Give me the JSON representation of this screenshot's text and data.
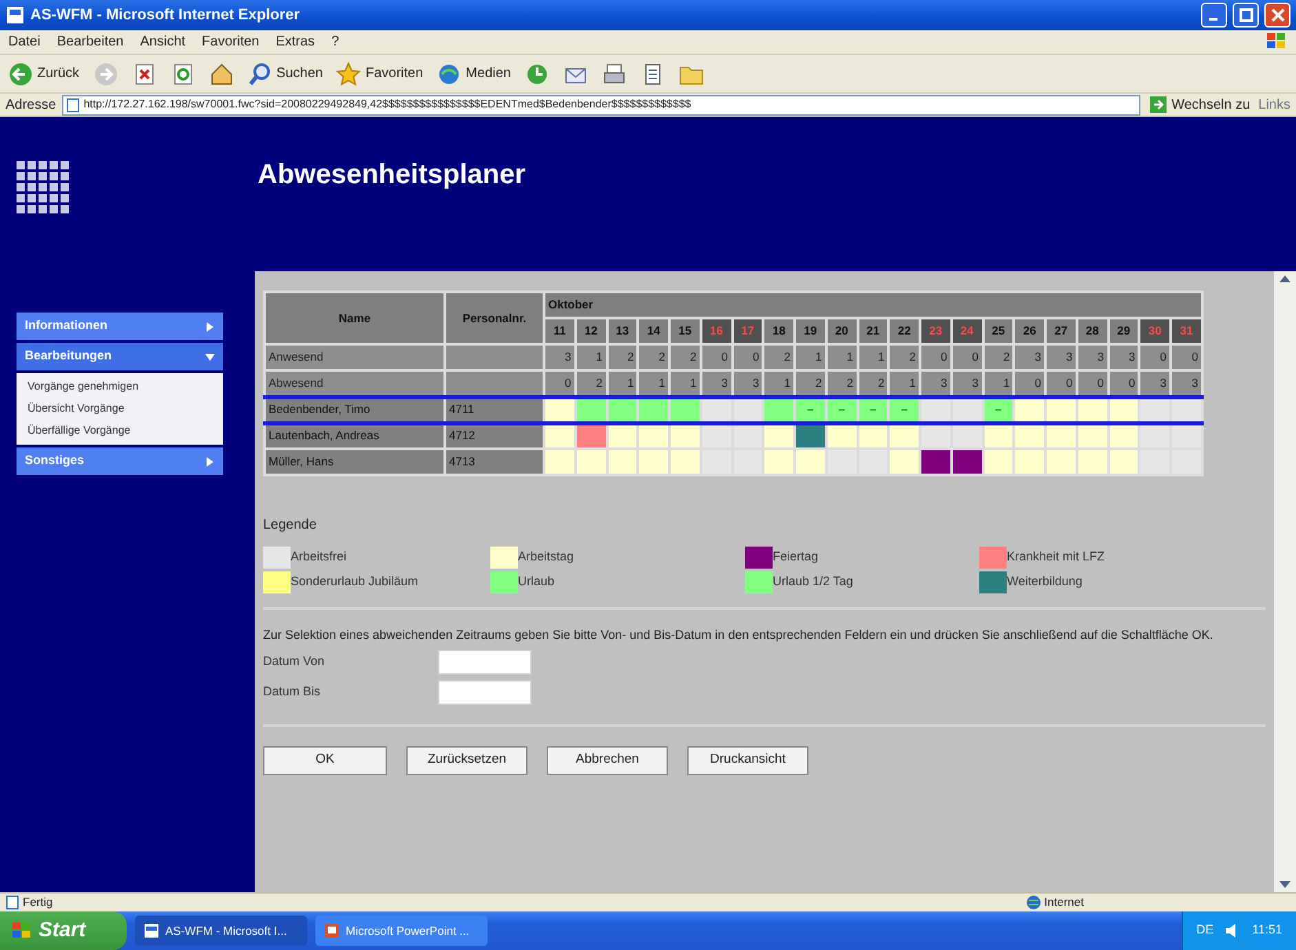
{
  "window": {
    "title": "AS-WFM - Microsoft Internet Explorer"
  },
  "menu": [
    "Datei",
    "Bearbeiten",
    "Ansicht",
    "Favoriten",
    "Extras",
    "?"
  ],
  "toolbar": [
    {
      "kind": "back",
      "label": "Zurück"
    },
    {
      "kind": "forward"
    },
    {
      "kind": "stop"
    },
    {
      "kind": "refresh"
    },
    {
      "kind": "home"
    },
    {
      "kind": "search",
      "label": "Suchen"
    },
    {
      "kind": "favorites",
      "label": "Favoriten"
    },
    {
      "kind": "media",
      "label": "Medien"
    },
    {
      "kind": "history"
    },
    {
      "kind": "mail"
    },
    {
      "kind": "print"
    },
    {
      "kind": "edit"
    },
    {
      "kind": "folder"
    }
  ],
  "address": {
    "label": "Adresse",
    "url": "http://172.27.162.198/sw70001.fwc?sid=20080229492849,42$$$$$$$$$$$$$$$$EDENTmed$Bedenbender$$$$$$$$$$$$$",
    "go": "Wechseln zu",
    "links": "Links"
  },
  "page": {
    "title": "Abwesenheitsplaner"
  },
  "sidebar": {
    "items": [
      {
        "label": "Informationen",
        "expanded": false
      },
      {
        "label": "Bearbeitungen",
        "expanded": true,
        "children": [
          {
            "label": "Vorgänge genehmigen"
          },
          {
            "label": "Übersicht Vorgänge"
          },
          {
            "label": "Überfällige Vorgänge"
          }
        ]
      },
      {
        "label": "Sonstiges",
        "expanded": false
      }
    ]
  },
  "planner": {
    "columns": [
      "Name",
      "Personalnr."
    ],
    "month": "Oktober",
    "days": [
      {
        "label": "11",
        "weekend": false
      },
      {
        "label": "12",
        "weekend": false
      },
      {
        "label": "13",
        "weekend": false
      },
      {
        "label": "14",
        "weekend": false
      },
      {
        "label": "15",
        "weekend": false
      },
      {
        "label": "16",
        "weekend": true
      },
      {
        "label": "17",
        "weekend": true
      },
      {
        "label": "18",
        "weekend": false
      },
      {
        "label": "19",
        "weekend": false
      },
      {
        "label": "20",
        "weekend": false
      },
      {
        "label": "21",
        "weekend": false
      },
      {
        "label": "22",
        "weekend": false
      },
      {
        "label": "23",
        "weekend": true
      },
      {
        "label": "24",
        "weekend": true
      },
      {
        "label": "25",
        "weekend": false
      },
      {
        "label": "26",
        "weekend": false
      },
      {
        "label": "27",
        "weekend": false
      },
      {
        "label": "28",
        "weekend": false
      },
      {
        "label": "29",
        "weekend": false
      },
      {
        "label": "30",
        "weekend": true
      },
      {
        "label": "31",
        "weekend": true
      }
    ],
    "summary": [
      {
        "label": "Anwesend",
        "values": [
          "3",
          "1",
          "2",
          "2",
          "2",
          "0",
          "0",
          "2",
          "1",
          "1",
          "1",
          "2",
          "0",
          "0",
          "2",
          "3",
          "3",
          "3",
          "3",
          "0",
          "0"
        ]
      },
      {
        "label": "Abwesend",
        "values": [
          "0",
          "2",
          "1",
          "1",
          "1",
          "3",
          "3",
          "1",
          "2",
          "2",
          "2",
          "1",
          "3",
          "3",
          "1",
          "0",
          "0",
          "0",
          "0",
          "3",
          "3"
        ]
      }
    ],
    "rows": [
      {
        "name": "Bedenbender, Timo",
        "number": "4711",
        "selected": true,
        "cells": [
          {
            "kind": "work"
          },
          {
            "kind": "vacation"
          },
          {
            "kind": "vacation"
          },
          {
            "kind": "vacation"
          },
          {
            "kind": "vacation"
          },
          {
            "kind": "free"
          },
          {
            "kind": "free"
          },
          {
            "kind": "vacation"
          },
          {
            "kind": "half",
            "text": "–"
          },
          {
            "kind": "half",
            "text": "–"
          },
          {
            "kind": "half",
            "text": "–"
          },
          {
            "kind": "half",
            "text": "–"
          },
          {
            "kind": "free"
          },
          {
            "kind": "free"
          },
          {
            "kind": "half",
            "text": "–"
          },
          {
            "kind": "work"
          },
          {
            "kind": "work"
          },
          {
            "kind": "work"
          },
          {
            "kind": "work"
          },
          {
            "kind": "free"
          },
          {
            "kind": "free"
          }
        ]
      },
      {
        "name": "Lautenbach, Andreas",
        "number": "4712",
        "selected": false,
        "cells": [
          {
            "kind": "work"
          },
          {
            "kind": "sick"
          },
          {
            "kind": "work"
          },
          {
            "kind": "work"
          },
          {
            "kind": "work"
          },
          {
            "kind": "free"
          },
          {
            "kind": "free"
          },
          {
            "kind": "work"
          },
          {
            "kind": "training"
          },
          {
            "kind": "work"
          },
          {
            "kind": "work"
          },
          {
            "kind": "work"
          },
          {
            "kind": "free"
          },
          {
            "kind": "free"
          },
          {
            "kind": "work"
          },
          {
            "kind": "work"
          },
          {
            "kind": "work"
          },
          {
            "kind": "work"
          },
          {
            "kind": "work"
          },
          {
            "kind": "free"
          },
          {
            "kind": "free"
          }
        ]
      },
      {
        "name": "Müller, Hans",
        "number": "4713",
        "selected": false,
        "cells": [
          {
            "kind": "work"
          },
          {
            "kind": "work"
          },
          {
            "kind": "work"
          },
          {
            "kind": "work"
          },
          {
            "kind": "work"
          },
          {
            "kind": "free"
          },
          {
            "kind": "free"
          },
          {
            "kind": "work"
          },
          {
            "kind": "work"
          },
          {
            "kind": "free"
          },
          {
            "kind": "free"
          },
          {
            "kind": "work"
          },
          {
            "kind": "holiday"
          },
          {
            "kind": "holiday"
          },
          {
            "kind": "work"
          },
          {
            "kind": "work"
          },
          {
            "kind": "work"
          },
          {
            "kind": "work"
          },
          {
            "kind": "work"
          },
          {
            "kind": "free"
          },
          {
            "kind": "free"
          }
        ]
      }
    ]
  },
  "legend": {
    "title": "Legende",
    "items": [
      {
        "kind": "free",
        "label": "Arbeitsfrei",
        "color": "#e6e6e6"
      },
      {
        "kind": "work",
        "label": "Arbeitstag",
        "color": "#ffffcc"
      },
      {
        "kind": "holiday",
        "label": "Feiertag",
        "color": "#800080"
      },
      {
        "kind": "sick",
        "label": "Krankheit mit LFZ",
        "color": "#ff8080"
      },
      {
        "kind": "special",
        "label": "Sonderurlaub Jubiläum",
        "color": "#ffff80"
      },
      {
        "kind": "vacation",
        "label": "Urlaub",
        "color": "#80ff80"
      },
      {
        "kind": "half",
        "label": "Urlaub 1/2 Tag",
        "color": "#80ff80"
      },
      {
        "kind": "training",
        "label": "Weiterbildung",
        "color": "#2e8080"
      }
    ]
  },
  "form": {
    "hint": "Zur Selektion eines abweichenden Zeitraums geben Sie bitte Von- und Bis-Datum in den entsprechenden Feldern ein und drücken Sie anschließend auf die Schaltfläche OK.",
    "fields": [
      {
        "label": "Datum Von"
      },
      {
        "label": "Datum Bis"
      }
    ]
  },
  "buttons": [
    "OK",
    "Zurücksetzen",
    "Abbrechen",
    "Druckansicht"
  ],
  "status_bar": {
    "text": "Fertig",
    "zone": "Internet"
  },
  "taskbar": {
    "start": "Start",
    "tasks": [
      {
        "label": "AS-WFM - Microsoft I...",
        "selected": true
      },
      {
        "label": "Microsoft PowerPoint ...",
        "selected": false
      }
    ],
    "language": "DE",
    "clock": "11:51"
  }
}
